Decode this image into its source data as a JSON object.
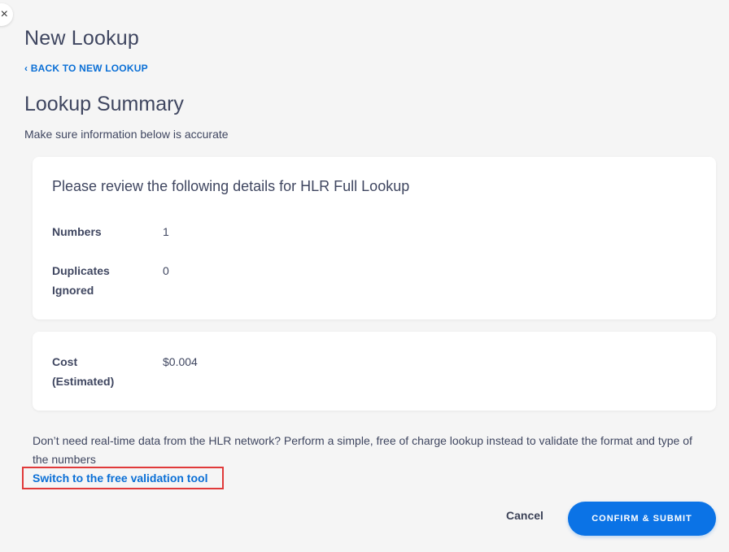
{
  "close_glyph": "×",
  "page_title": "New Lookup",
  "back_link": "‹ BACK TO NEW LOOKUP",
  "section_title": "Lookup Summary",
  "subtitle": "Make sure information below is accurate",
  "review_card": {
    "heading": "Please review the following details for HLR Full Lookup",
    "rows": [
      {
        "label": "Numbers",
        "value": "1"
      },
      {
        "label": "Duplicates Ignored",
        "value": "0"
      }
    ]
  },
  "cost_card": {
    "label": "Cost (Estimated)",
    "value": "$0.004"
  },
  "info_text": "Don’t need real-time data from the HLR network? Perform a simple, free of charge lookup instead to validate the format and type of the numbers",
  "free_link": "Switch to the free validation tool",
  "actions": {
    "cancel": "Cancel",
    "confirm": "CONFIRM & SUBMIT"
  },
  "colors": {
    "accent": "#0b73e6",
    "link": "#0a6fd6",
    "highlight_border": "#e03a3a",
    "background": "#f5f5f5"
  }
}
